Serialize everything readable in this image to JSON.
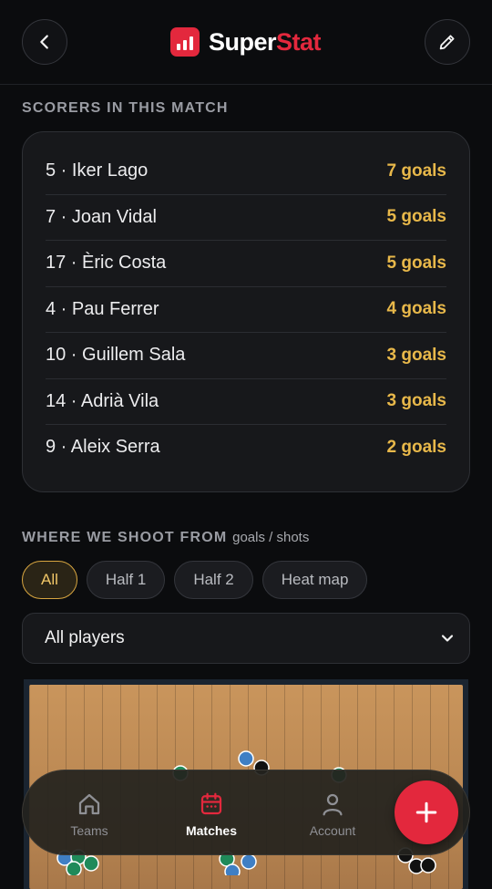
{
  "app": {
    "name_part1": "Super",
    "name_part2": "Stat"
  },
  "scorers": {
    "title": "SCORERS IN THIS MATCH",
    "rows": [
      {
        "name": "5 · Iker Lago",
        "goals": "7 goals"
      },
      {
        "name": "7 · Joan Vidal",
        "goals": "5 goals"
      },
      {
        "name": "17 · Èric Costa",
        "goals": "5 goals"
      },
      {
        "name": "4 · Pau Ferrer",
        "goals": "4 goals"
      },
      {
        "name": "10 · Guillem Sala",
        "goals": "3 goals"
      },
      {
        "name": "14 · Adrià Vila",
        "goals": "3 goals"
      },
      {
        "name": "9 · Aleix Serra",
        "goals": "2 goals"
      }
    ]
  },
  "shots": {
    "title": "WHERE WE SHOOT FROM",
    "subtitle": "goals / shots",
    "filters": [
      "All",
      "Half 1",
      "Half 2",
      "Heat map"
    ],
    "active_filter": "All",
    "player_select": "All players"
  },
  "shot_markers": {
    "colors": {
      "goal": "#1f8a5a",
      "shot": "#3f7fc4",
      "miss": "#111111"
    }
  },
  "nav": {
    "items": [
      {
        "label": "Teams",
        "icon": "home-icon"
      },
      {
        "label": "Matches",
        "icon": "calendar-icon"
      },
      {
        "label": "Account",
        "icon": "user-icon"
      }
    ],
    "active": "Matches",
    "fab_icon": "plus-icon"
  },
  "colors": {
    "accent": "#e3283d",
    "gold": "#e8b84a",
    "background": "#0b0c0e"
  }
}
